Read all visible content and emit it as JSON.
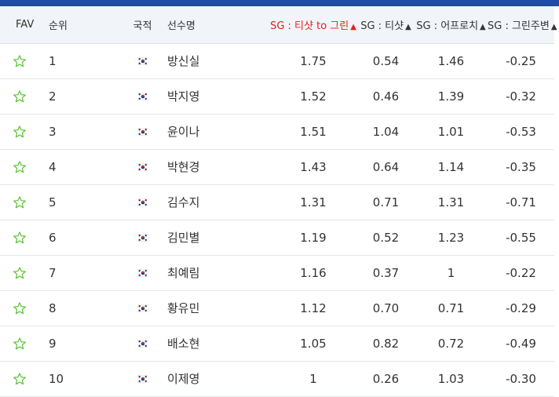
{
  "colors": {
    "header_bar": "#1f4ea1",
    "sorted_header": "#e0201c",
    "fav_star": "#5bc236"
  },
  "icons": {
    "fav": "star-outline-icon",
    "nationality": "korea-flag-icon"
  },
  "columns": {
    "fav": "FAV",
    "rank": "순위",
    "nationality": "국적",
    "player": "선수명",
    "sg_tee_to_green": "SG : 티샷 to 그린",
    "sg_tee": "SG : 티샷",
    "sg_approach": "SG : 어프로치",
    "sg_around_green": "SG : 그린주변"
  },
  "sort_arrow": "▲",
  "rows": [
    {
      "rank": "1",
      "player": "방신실",
      "sg_tee_to_green": "1.75",
      "sg_tee": "0.54",
      "sg_approach": "1.46",
      "sg_around_green": "-0.25"
    },
    {
      "rank": "2",
      "player": "박지영",
      "sg_tee_to_green": "1.52",
      "sg_tee": "0.46",
      "sg_approach": "1.39",
      "sg_around_green": "-0.32"
    },
    {
      "rank": "3",
      "player": "윤이나",
      "sg_tee_to_green": "1.51",
      "sg_tee": "1.04",
      "sg_approach": "1.01",
      "sg_around_green": "-0.53"
    },
    {
      "rank": "4",
      "player": "박현경",
      "sg_tee_to_green": "1.43",
      "sg_tee": "0.64",
      "sg_approach": "1.14",
      "sg_around_green": "-0.35"
    },
    {
      "rank": "5",
      "player": "김수지",
      "sg_tee_to_green": "1.31",
      "sg_tee": "0.71",
      "sg_approach": "1.31",
      "sg_around_green": "-0.71"
    },
    {
      "rank": "6",
      "player": "김민별",
      "sg_tee_to_green": "1.19",
      "sg_tee": "0.52",
      "sg_approach": "1.23",
      "sg_around_green": "-0.55"
    },
    {
      "rank": "7",
      "player": "최예림",
      "sg_tee_to_green": "1.16",
      "sg_tee": "0.37",
      "sg_approach": "1",
      "sg_around_green": "-0.22"
    },
    {
      "rank": "8",
      "player": "황유민",
      "sg_tee_to_green": "1.12",
      "sg_tee": "0.70",
      "sg_approach": "0.71",
      "sg_around_green": "-0.29"
    },
    {
      "rank": "9",
      "player": "배소현",
      "sg_tee_to_green": "1.05",
      "sg_tee": "0.82",
      "sg_approach": "0.72",
      "sg_around_green": "-0.49"
    },
    {
      "rank": "10",
      "player": "이제영",
      "sg_tee_to_green": "1",
      "sg_tee": "0.26",
      "sg_approach": "1.03",
      "sg_around_green": "-0.30"
    }
  ]
}
